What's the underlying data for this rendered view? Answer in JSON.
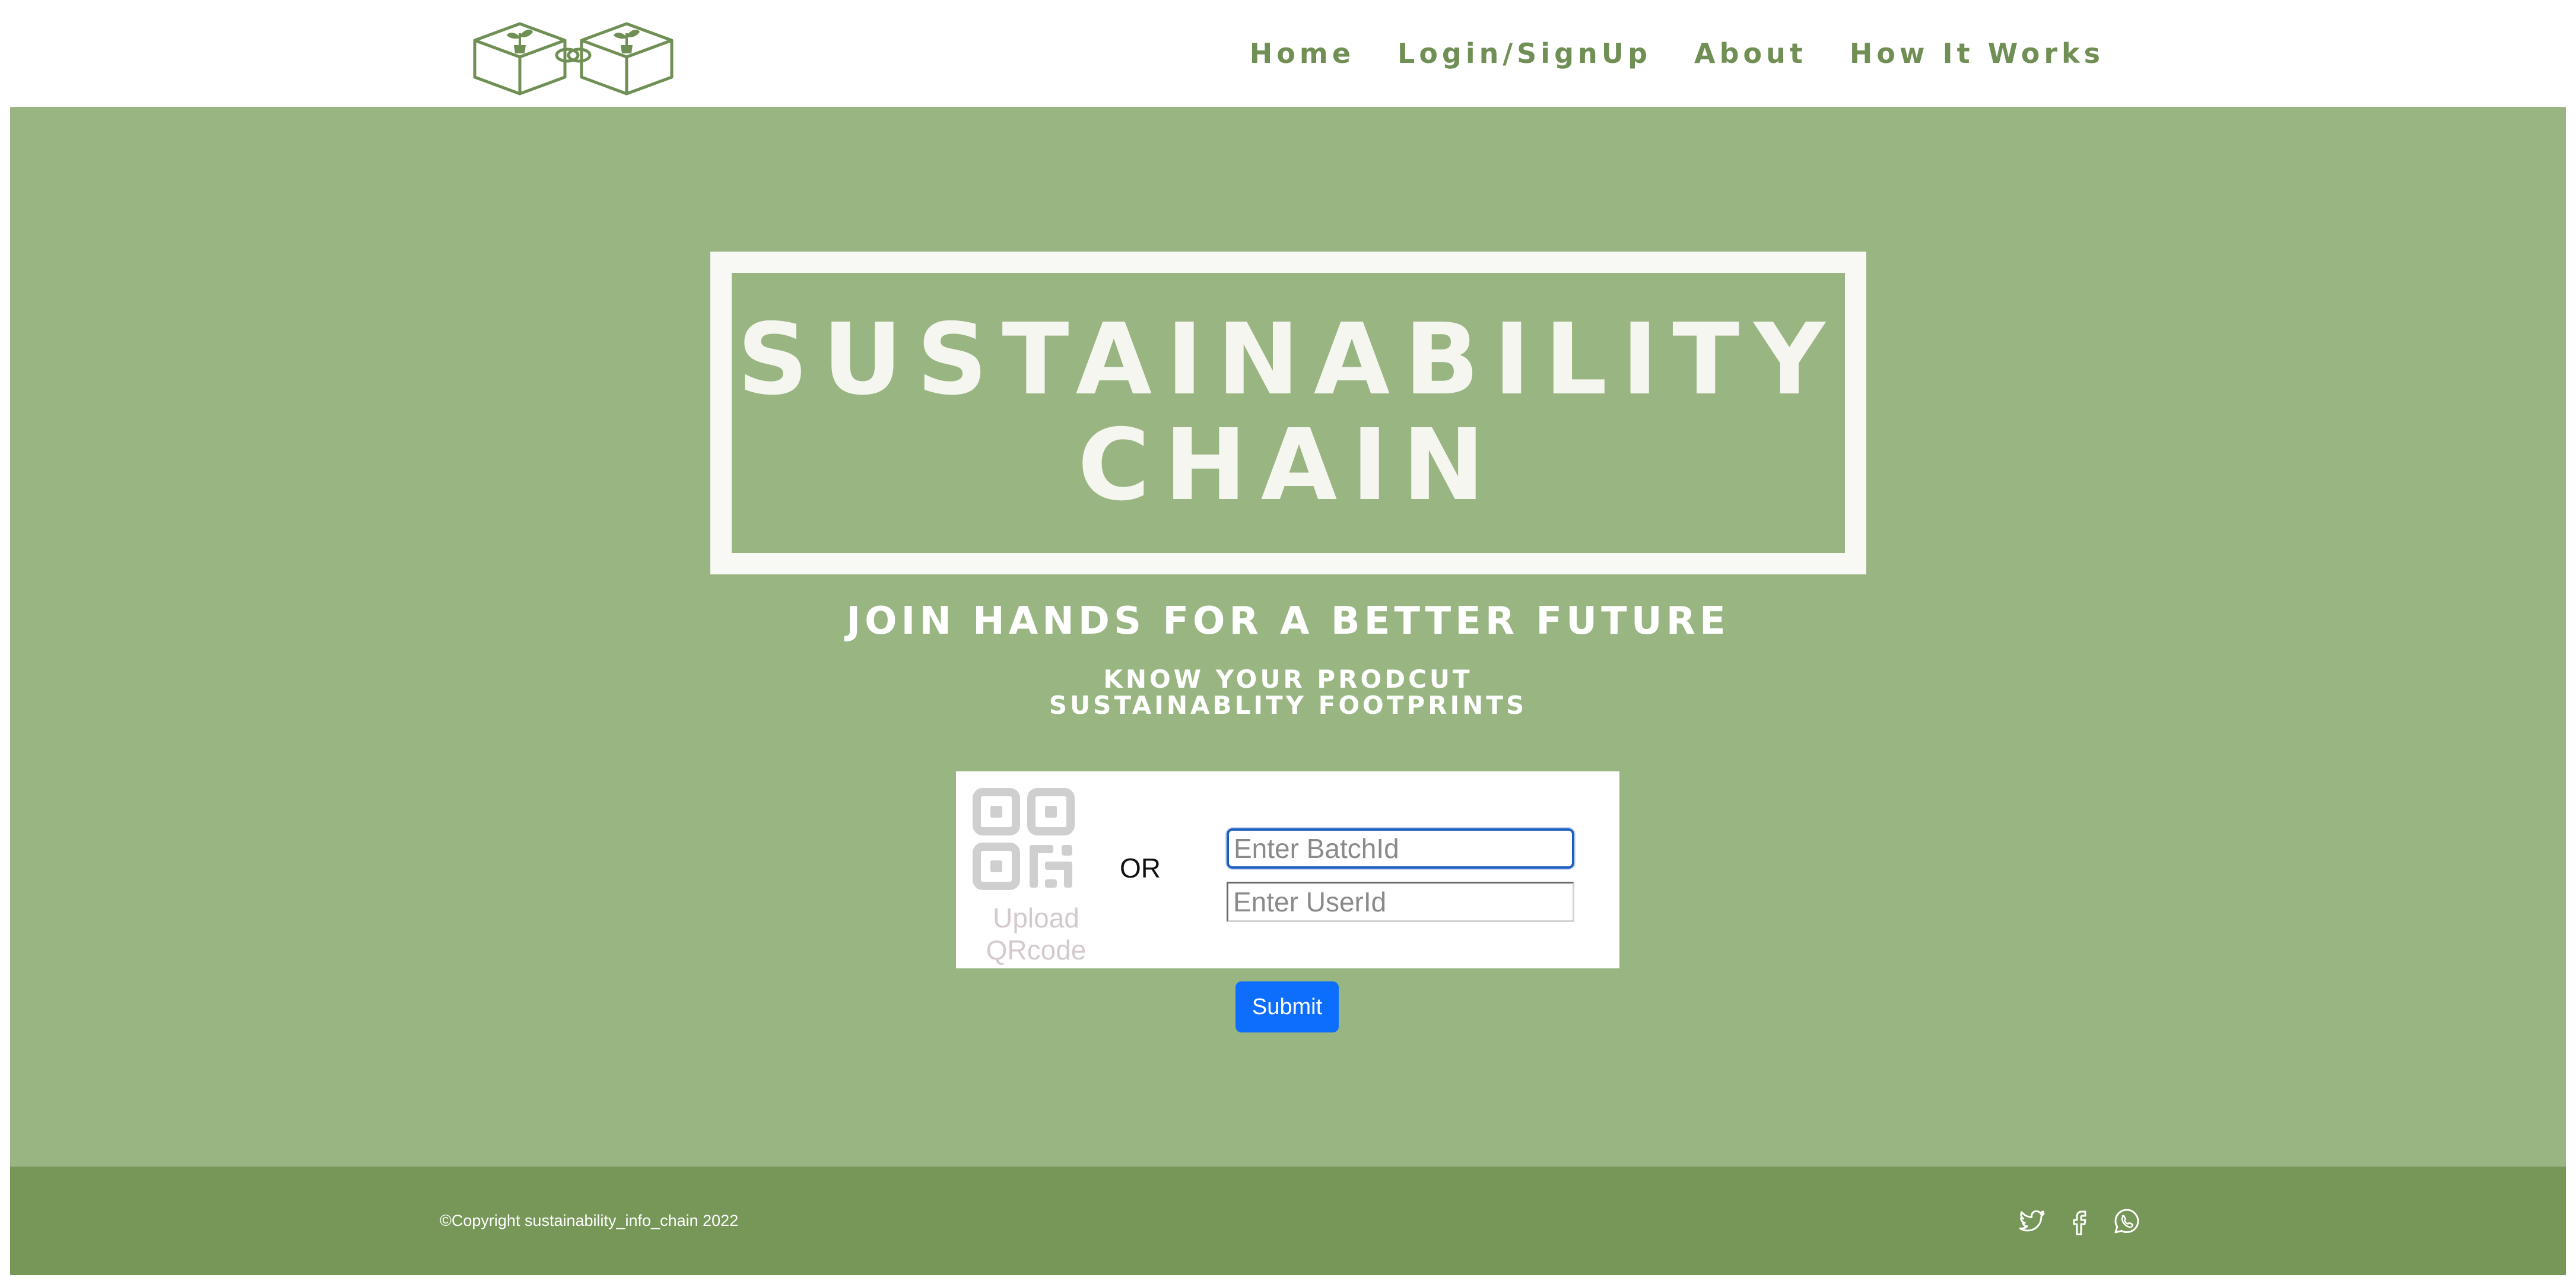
{
  "header": {
    "nav": {
      "home": "Home",
      "login": "Login/SignUp",
      "about": "About",
      "how_it_works": "How It Works"
    },
    "logo_icon": "blockchain-cubes-with-sprouts-logo"
  },
  "hero": {
    "title_line1": "SUSTAINABILITY",
    "title_line2": "CHAIN",
    "tagline": "JOIN HANDS FOR A BETTER FUTURE",
    "sub_line1": "KNOW YOUR PRODCUT",
    "sub_line2": "SUSTAINABLITY FOOTPRINTS"
  },
  "form": {
    "upload_line1": "Upload",
    "upload_line2": "QRcode",
    "or_label": "OR",
    "batch_placeholder": "Enter BatchId",
    "user_placeholder": "Enter UserId",
    "submit_label": "Submit",
    "qr_icon": "qr-code-icon"
  },
  "footer": {
    "copyright": "©Copyright sustainability_info_chain 2022",
    "social": [
      "twitter-icon",
      "facebook-icon",
      "whatsapp-icon"
    ]
  },
  "colors": {
    "brand_green": "#99b682",
    "nav_green": "#6f8f54",
    "footer_green": "#769758",
    "submit_blue": "#0d6efd"
  }
}
